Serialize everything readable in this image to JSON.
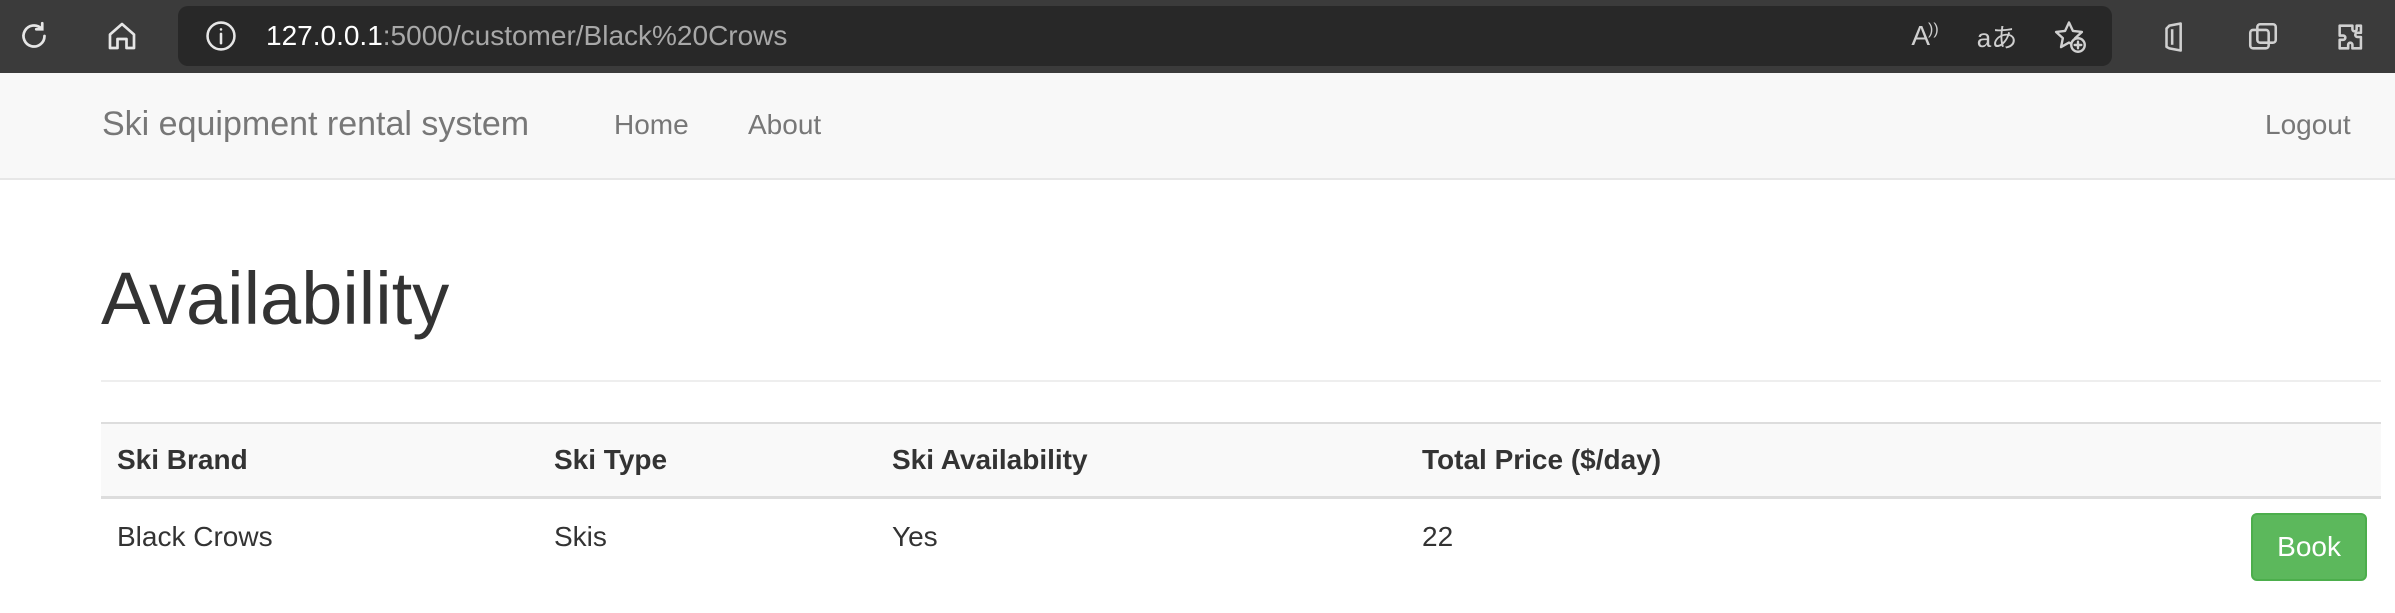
{
  "browser": {
    "url_host": "127.0.0.1",
    "url_rest": ":5000/customer/Black%20Crows",
    "icons": [
      "refresh-icon",
      "home-icon",
      "info-icon",
      "read-aloud-icon",
      "translate-icon",
      "favorite-add-icon",
      "office-icon",
      "collections-icon",
      "extensions-icon"
    ],
    "read_aloud_glyph": "A",
    "translate_glyph": "aあ"
  },
  "navbar": {
    "brand": "Ski equipment rental system",
    "home": "Home",
    "about": "About",
    "logout": "Logout"
  },
  "main": {
    "title": "Availability",
    "table": {
      "headers": [
        "Ski Brand",
        "Ski Type",
        "Ski Availability",
        "Total Price ($/day)"
      ],
      "rows": [
        {
          "brand": "Black Crows",
          "type": "Skis",
          "availability": "Yes",
          "price": "22",
          "action": "Book"
        }
      ]
    }
  },
  "colors": {
    "button_success": "#5cb85c",
    "navbar_bg": "#f8f8f8",
    "browser_bar": "#3b3b3b"
  }
}
